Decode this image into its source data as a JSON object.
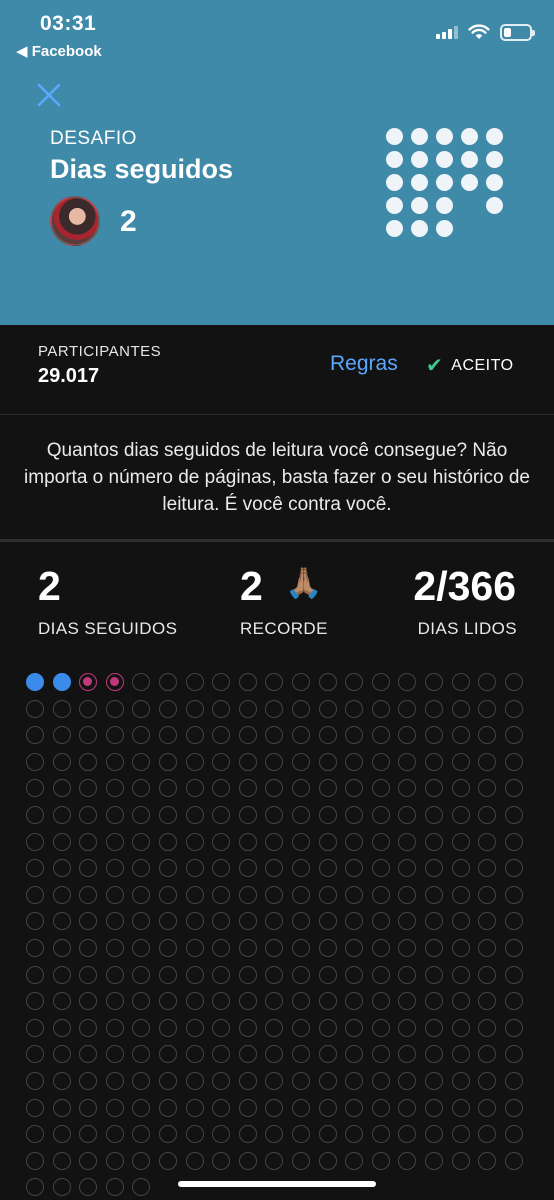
{
  "status_bar": {
    "time": "03:31",
    "back_label": "◀ Facebook"
  },
  "challenge": {
    "kicker": "DESAFIO",
    "title": "Dias seguidos",
    "count": "2"
  },
  "meta": {
    "participants_label": "PARTICIPANTES",
    "participants_value": "29.017",
    "rules_label": "Regras",
    "accepted_label": "ACEITO"
  },
  "description": "Quantos dias seguidos de leitura você consegue? Não importa o número de páginas, basta fazer o seu histórico de leitura. É você contra você.",
  "stats": {
    "streak_value": "2",
    "streak_label": "DIAS SEGUIDOS",
    "record_value": "2",
    "record_emoji": "🙏🏽",
    "record_label": "RECORDE",
    "days_read_value": "2/366",
    "days_read_label": "DIAS LIDOS"
  },
  "calendar": {
    "total_days": 366,
    "read_days": [
      0,
      1
    ],
    "marked_days": [
      2,
      3
    ],
    "colors": {
      "read": "#3b8beb",
      "marked": "#c0397c",
      "empty": "#444444"
    }
  },
  "colors": {
    "header_bg": "#3f8aa8",
    "accent": "#5ba8ff",
    "check": "#3ec98a",
    "background": "#121212"
  }
}
